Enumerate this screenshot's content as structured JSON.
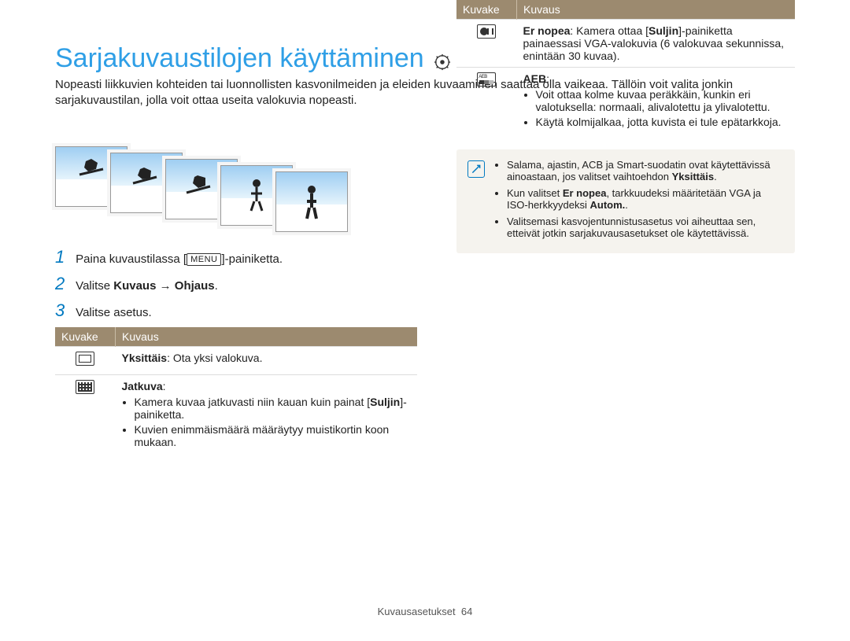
{
  "title": "Sarjakuvaustilojen käyttäminen",
  "intro": "Nopeasti liikkuvien kohteiden tai luonnollisten kasvonilmeiden ja eleiden kuvaaminen saattaa olla vaikeaa. Tällöin voit valita jonkin sarjakuvaustilan, jolla voit ottaa useita valokuvia nopeasti.",
  "steps": {
    "s1_a": "Paina kuvaustilassa [",
    "s1_menu": "MENU",
    "s1_b": "]-painiketta.",
    "s2_a": "Valitse ",
    "s2_b": "Kuvaus",
    "s2_arrow": " → ",
    "s2_c": "Ohjaus",
    "s2_d": ".",
    "s3": "Valitse asetus."
  },
  "headers": {
    "icon": "Kuvake",
    "desc": "Kuvaus"
  },
  "leftTable": {
    "r1": {
      "b": "Yksittäis",
      "t": ": Ota yksi valokuva."
    },
    "r2": {
      "title": "Jatkuva",
      "li1a": "Kamera kuvaa jatkuvasti niin kauan kuin painat [",
      "li1b": "Suljin",
      "li1c": "]-painiketta.",
      "li2": "Kuvien enimmäismäärä määräytyy muistikortin koon mukaan."
    }
  },
  "rightTable": {
    "r1": {
      "b1": "Er nopea",
      "t1": ": Kamera ottaa [",
      "b2": "Suljin",
      "t2": "]-painiketta painaessasi VGA-valokuvia (6 valokuvaa sekunnissa, enintään 30 kuvaa)."
    },
    "r2": {
      "title": "AEB",
      "li1": "Voit ottaa kolme kuvaa peräkkäin, kunkin eri valotuksella: normaali, alivalotettu ja ylivalotettu.",
      "li2": "Käytä kolmijalkaa, jotta kuvista ei tule epätarkkoja."
    }
  },
  "note": {
    "li1a": "Salama, ajastin, ACB ja Smart-suodatin ovat käytettävissä ainoastaan, jos valitset vaihtoehdon ",
    "li1b": "Yksittäis",
    "li1c": ".",
    "li2a": "Kun valitset ",
    "li2b": "Er nopea",
    "li2c": ", tarkkuudeksi määritetään VGA ja ISO-herkkyydeksi ",
    "li2d": "Autom.",
    "li2e": ".",
    "li3": "Valitsemasi kasvojentunnistusasetus voi aiheuttaa sen, etteivät jotkin sarjakuvausasetukset ole käytettävissä."
  },
  "footer": {
    "label": "Kuvausasetukset",
    "page": "64"
  }
}
